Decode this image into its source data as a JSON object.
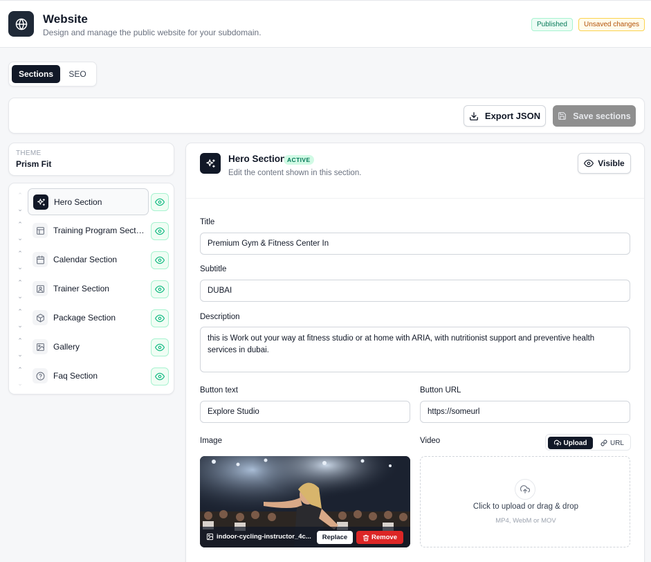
{
  "header": {
    "title": "Website",
    "subtitle": "Design and manage the public website for your subdomain.",
    "badge_published": "Published",
    "badge_unsaved": "Unsaved changes"
  },
  "tabs": {
    "sections": "Sections",
    "seo": "SEO",
    "active": "Sections"
  },
  "toolbar": {
    "export_label": "Export JSON",
    "save_label": "Save sections",
    "save_disabled": true
  },
  "theme": {
    "label": "THEME",
    "name": "Prism Fit"
  },
  "sections": [
    {
      "label": "Hero Section",
      "icon": "sparkles-icon",
      "active": true,
      "visible": true
    },
    {
      "label": "Training Program Secti...",
      "icon": "layout-icon",
      "active": false,
      "visible": true
    },
    {
      "label": "Calendar Section",
      "icon": "calendar-icon",
      "active": false,
      "visible": true
    },
    {
      "label": "Trainer Section",
      "icon": "user-square-icon",
      "active": false,
      "visible": true
    },
    {
      "label": "Package Section",
      "icon": "package-icon",
      "active": false,
      "visible": true
    },
    {
      "label": "Gallery",
      "icon": "image-icon",
      "active": false,
      "visible": true
    },
    {
      "label": "Faq Section",
      "icon": "help-circle-icon",
      "active": false,
      "visible": true
    }
  ],
  "editor": {
    "title": "Hero Section",
    "badge": "ACTIVE",
    "subtitle": "Edit the content shown in this section.",
    "visible_label": "Visible",
    "fields": {
      "title_label": "Title",
      "title_value": "Premium Gym & Fitness Center In",
      "subtitle_label": "Subtitle",
      "subtitle_value": "DUBAI",
      "description_label": "Description",
      "description_value": "this is Work out your way at fitness studio or at home with ARIA, with nutritionist support and preventive health services in dubai.",
      "button_text_label": "Button text",
      "button_text_value": "Explore Studio",
      "button_url_label": "Button URL",
      "button_url_value": "https://someurl",
      "image_label": "Image",
      "video_label": "Video"
    },
    "image": {
      "filename": "indoor-cycling-instructor_4c...",
      "replace_label": "Replace",
      "remove_label": "Remove"
    },
    "video": {
      "mode_upload": "Upload",
      "mode_url": "URL",
      "selected_mode": "Upload",
      "upload_text": "Click to upload or drag & drop",
      "upload_hint": "MP4, WebM or MOV"
    }
  },
  "colors": {
    "brand_dark": "#111827",
    "success": "#10b981",
    "danger": "#dc2626",
    "warning": "#b45309"
  }
}
